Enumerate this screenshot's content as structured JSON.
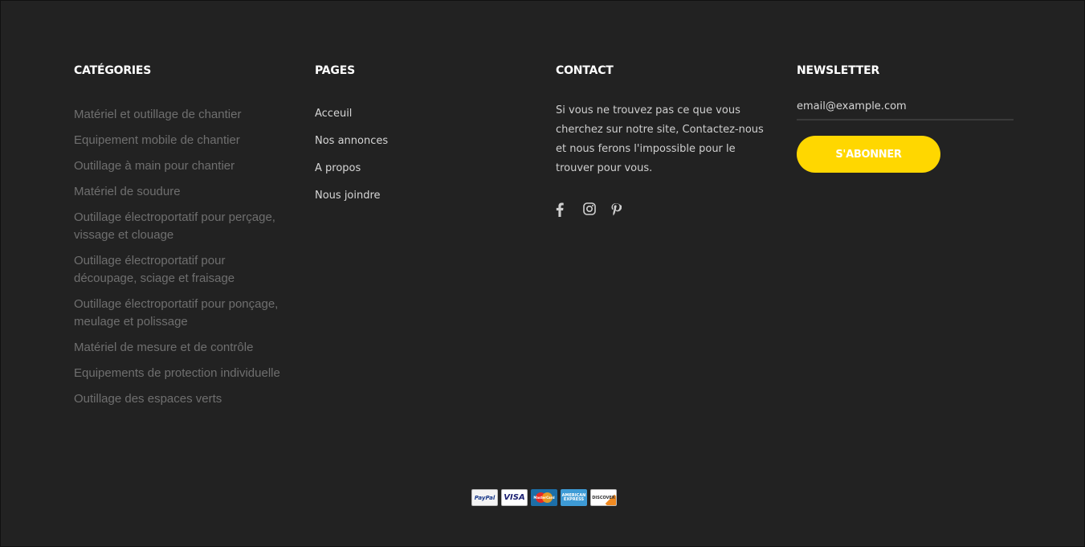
{
  "categories": {
    "title": "CATÉGORIES",
    "items": [
      "Matériel et outillage de chantier",
      "Equipement mobile de chantier",
      "Outillage à main pour chantier",
      "Matériel de soudure",
      "Outillage électroportatif pour perçage, vissage et clouage",
      "Outillage électroportatif pour découpage, sciage et fraisage",
      "Outillage électroportatif pour ponçage, meulage et polissage",
      "Matériel de mesure et de contrôle",
      "Equipements de protection individuelle",
      "Outillage des espaces verts"
    ]
  },
  "pages": {
    "title": "PAGES",
    "items": [
      "Acceuil",
      "Nos annonces",
      "A propos",
      "Nous joindre"
    ]
  },
  "contact": {
    "title": "CONTACT",
    "text": "Si vous ne trouvez pas ce que vous cherchez sur notre site, Contactez-nous et nous ferons l'impossible pour le trouver pour vous.",
    "social_icons": [
      "facebook-icon",
      "instagram-icon",
      "pinterest-icon"
    ]
  },
  "newsletter": {
    "title": "NEWSLETTER",
    "email_placeholder": "email@example.com",
    "subscribe_label": "S'ABONNER"
  },
  "payments": {
    "cards": [
      {
        "name": "paypal-icon",
        "label": "PayPal"
      },
      {
        "name": "visa-icon",
        "label": "VISA"
      },
      {
        "name": "mastercard-icon",
        "label": "MasterCard"
      },
      {
        "name": "amex-icon",
        "label": "AMERICAN EXPRESS"
      },
      {
        "name": "discover-icon",
        "label": "DISCOVER"
      }
    ]
  },
  "colors": {
    "background": "#222222",
    "accent": "#ffd700",
    "category_text": "#6f6f6f",
    "heading": "#ffffff"
  }
}
